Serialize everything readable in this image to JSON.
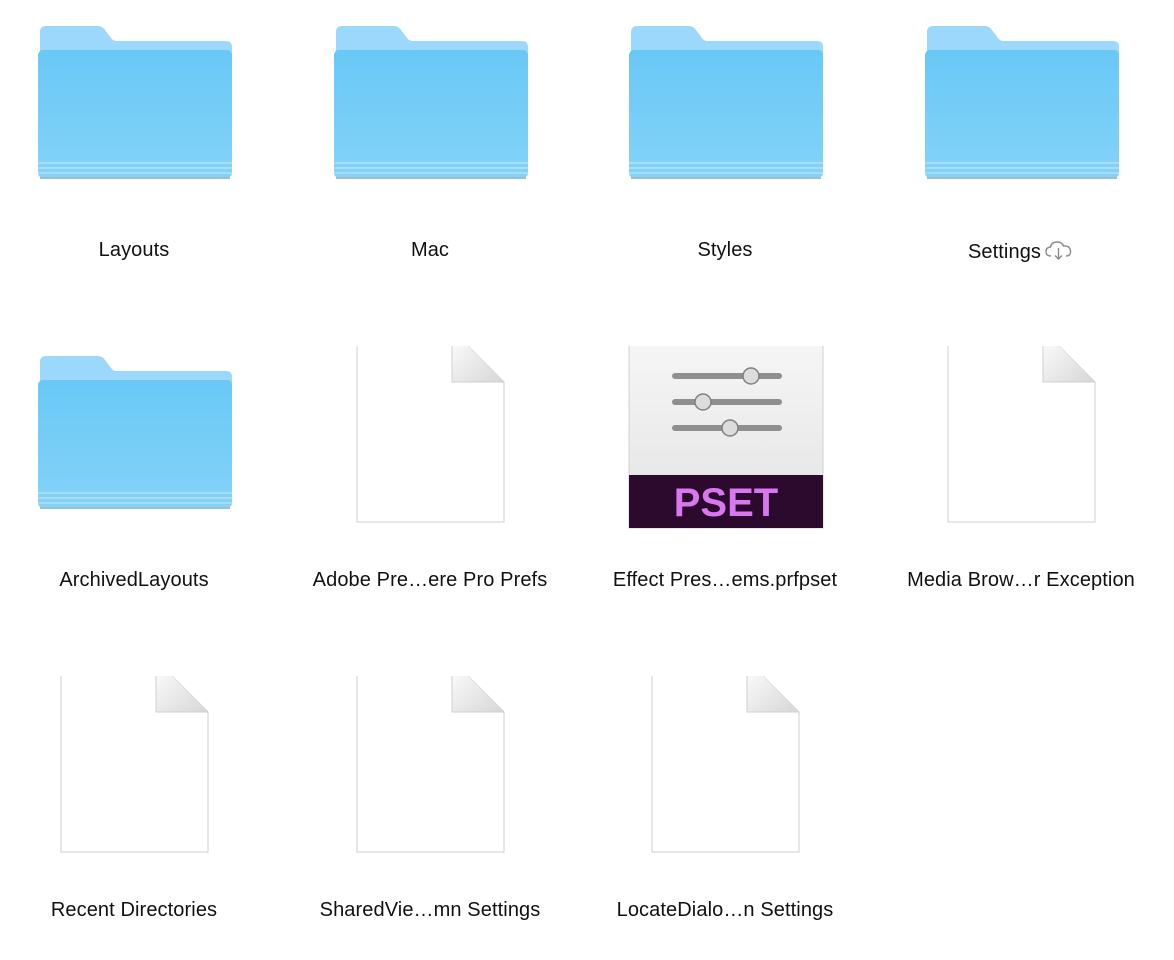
{
  "items": [
    {
      "label": "Layouts",
      "kind": "folder",
      "icon": "folder-icon"
    },
    {
      "label": "Mac",
      "kind": "folder",
      "icon": "folder-icon"
    },
    {
      "label": "Styles",
      "kind": "folder",
      "icon": "folder-icon"
    },
    {
      "label": "Settings",
      "kind": "folder",
      "icon": "folder-icon",
      "badge": "icloud-download-icon"
    },
    {
      "label": "ArchivedLayouts",
      "kind": "folder",
      "icon": "folder-icon"
    },
    {
      "label": "Adobe Pre…ere Pro Prefs",
      "kind": "document",
      "icon": "document-icon"
    },
    {
      "label": "Effect Pres…ems.prfpset",
      "kind": "pset",
      "icon": "pset-file-icon",
      "badge_text": "PSET"
    },
    {
      "label": "Media Brow…r Exception",
      "kind": "document",
      "icon": "document-icon"
    },
    {
      "label": "Recent Directories",
      "kind": "document",
      "icon": "document-icon"
    },
    {
      "label": "SharedVie…mn Settings",
      "kind": "document",
      "icon": "document-icon"
    },
    {
      "label": "LocateDialo…n Settings",
      "kind": "document",
      "icon": "document-icon"
    }
  ],
  "colors": {
    "folder_light": "#9fd9fb",
    "folder_main": "#6ac9f6",
    "pset_band": "#2b0a2e",
    "pset_text": "#d877f0"
  }
}
